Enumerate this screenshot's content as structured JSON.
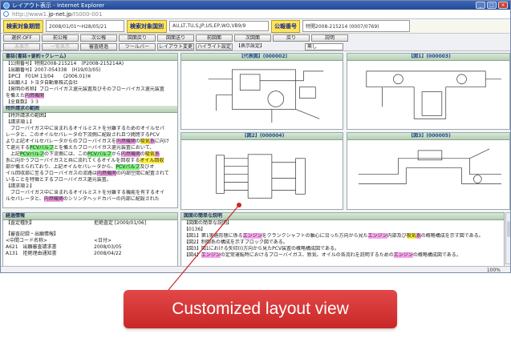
{
  "window": {
    "title": "レイアウト表示 - Internet Explorer",
    "url_prefix": "http://www1.",
    "url_host": "jp-net.jp",
    "url_path": "/IS000-001"
  },
  "search": {
    "period_label": "検索対象期間",
    "period_value": "2008/01/01〜H28/05/21",
    "country_label": "検索対象国別",
    "country_value": "AU,LT,TU,S,JP,US,EP,WO,VB9/9",
    "pubno_label": "公報番号",
    "pubno_value": "特開2008-215214 (0007/0769)"
  },
  "toolbar1": [
    "選択:OFF",
    "前公報",
    "次公報",
    "図面戻り",
    "図面送り",
    "前図面",
    "次図面",
    "戻り",
    "説明"
  ],
  "toolbar2": [
    "未表示",
    "一覧表示",
    "審査経過",
    "ツールバー",
    "レイアウト変更",
    "ハイライト設定"
  ],
  "toolbar2_sel_label": "【表示設定】",
  "toolbar2_sel_value": "無し",
  "left_pane": {
    "header1": "書誌(書誌+要約+クレーム)",
    "biblio": [
      "【公開番号】特開2008-215214　(P2008-215214A)",
      "【出願番号】2007-054338　(H19/03/05)",
      "【IPC】　F01M 13/04　　(2006.01)※",
      "【出願人】トヨタ自動車株式会社",
      "【発明の名称】ブローバイガス還元装置及びそのブローバイガス還元装置",
      "を備えた内燃機関",
      "【全頁数】３３"
    ],
    "header2": "特許請求の範囲",
    "claims": [
      "【特許請求の範囲】",
      "【請求項１】",
      "　ブローバイガス中に含まれるオイルミストを分離するためのオイルセパ",
      "レータと、このオイルセパレータの下流側に配設され且つ開閉するPCV",
      "より上記オイルセパレータからのブローバイガスを内燃機関の吸気系に向け",
      "て還元するPCVバルブとを備えたブローバイガス還元装置において、",
      "　上記PCVバルブの下流側には、このPCVバルブから内燃機関の吸気系",
      "系に向かうブローバイガスと共に流れてくるオイルを回収するオイル回収",
      "部が備えられており、上記オイルセパレータから、PCVバルブ及びオ",
      "イル回収部に至るブローバイガスの流路は内燃機関の内部空間に配置されて",
      "いることを特徴とするブローバイガス還元装置。",
      "【請求項２】",
      "　ブローバイガス中に含まれるオイルミストを分離する機能を有するオイ",
      "ルセパレータと、内燃機関のシリンダヘッドカバーの内部に配設された"
    ]
  },
  "grid": {
    "d1": "【代表図】(000002)",
    "d2": "【図1】(000003)",
    "d3": "【図2】(000004)",
    "d4": "【図3】(000005)"
  },
  "bottom_left": {
    "header": "経過情報",
    "rows1": [
      [
        "【査定種別】",
        "拒絶査定 [2009/01/06]"
      ]
    ],
    "rows2": [
      [
        "【審査記録・出願情報】",
        ""
      ],
      [
        "<中間コード名称>",
        "<日付>"
      ],
      [
        "A621　出願審査請求書",
        "2008/03/05"
      ],
      [
        "A131　拒絶理由通知書",
        "2008/04/22"
      ]
    ]
  },
  "bottom_right": {
    "header": "図面の簡単な説明",
    "lines": [
      "【図面の簡単な説明】",
      "【0136】",
      "【図1】第1実施形態に係るエンジンをクランクシャフトの軸心に沿った方向から見たエンジン内部及び吸気系の概略構成を示す図である。",
      "【図2】制御系の構成を示すブロック図である。",
      "【図3】図1における矢印(I)方向から見たPCV装置の概略構成図である。",
      "【図4】エンジンの定常運転時におけるブローバイガス、新気、オイルの各流れを説明するためのエンジンの概略構成図である。"
    ]
  },
  "status": {
    "zoom": "100%"
  },
  "callout": {
    "text": "Customized layout view"
  }
}
